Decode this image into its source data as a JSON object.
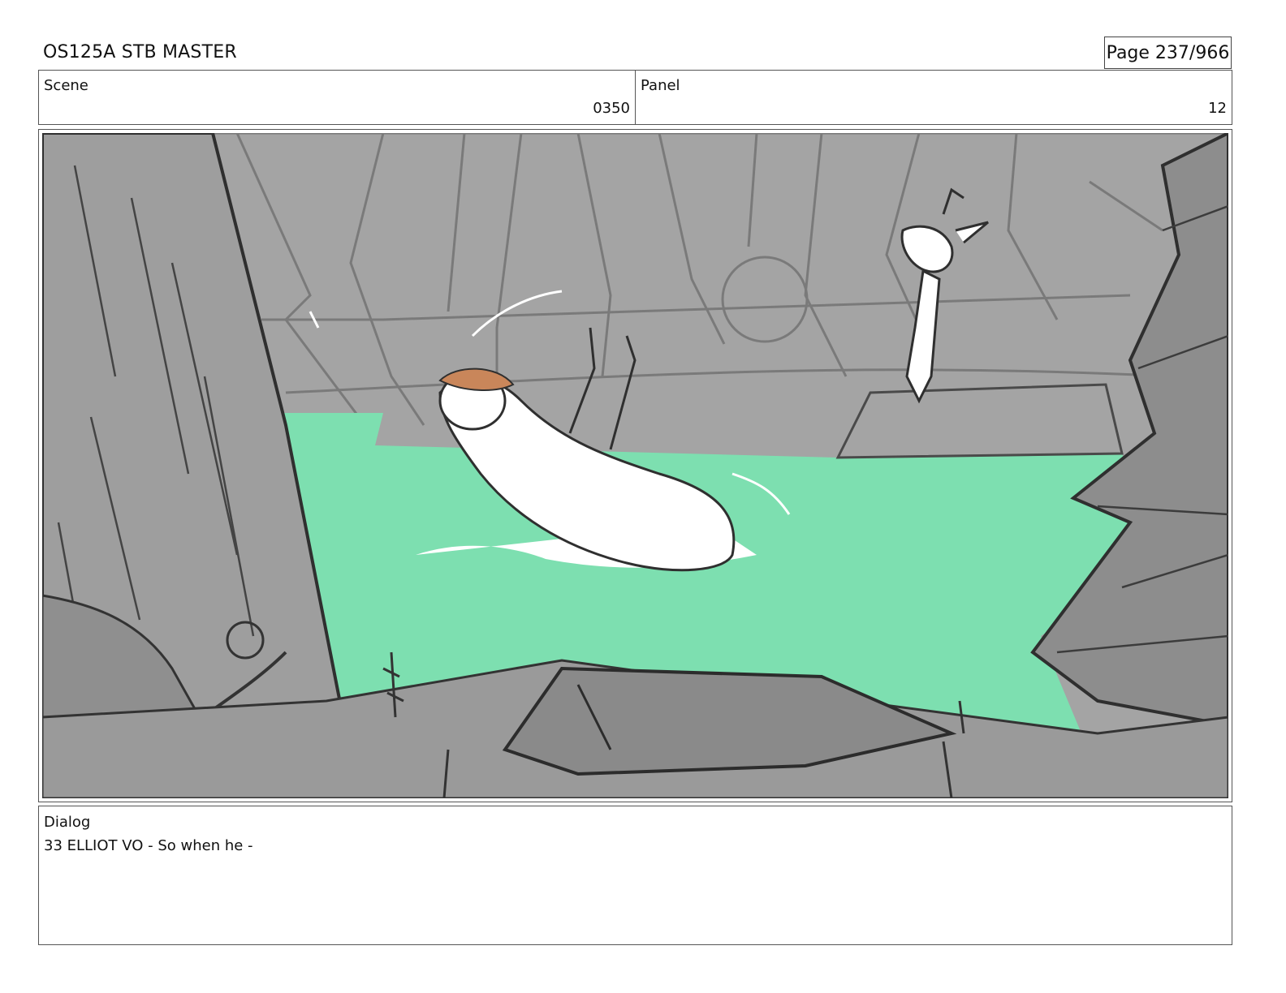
{
  "header": {
    "title": "OS125A STB MASTER",
    "page": "Page 237/966"
  },
  "scene": {
    "label": "Scene",
    "value": "0350"
  },
  "panel": {
    "label": "Panel",
    "value": "12"
  },
  "dialog": {
    "label": "Dialog",
    "text": "33 ELLIOT VO - So when he -"
  },
  "colors": {
    "water": "#7ddfb0",
    "forest": "#a4a4a4",
    "line": "#3a3a3a",
    "hat": "#c9865a"
  }
}
